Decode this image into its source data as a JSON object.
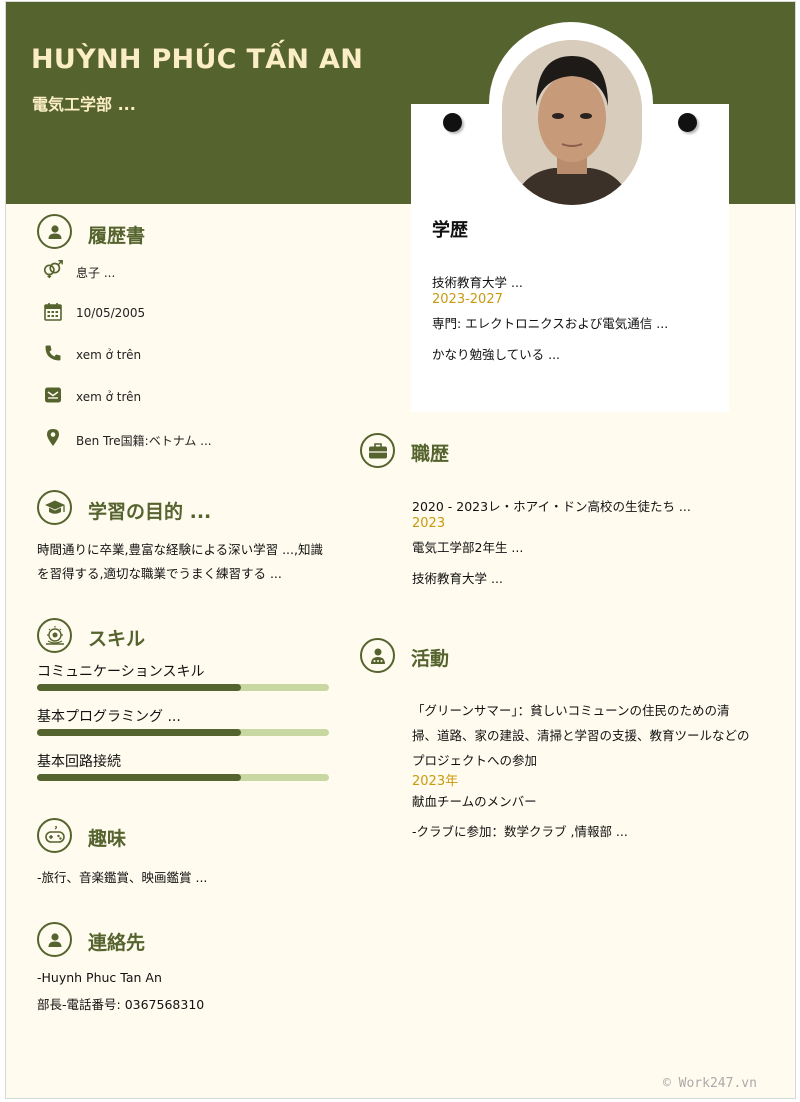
{
  "header": {
    "name": "HUỲNH PHÚC TẤN AN",
    "subtitle": "電気工学部 ..."
  },
  "profile": {
    "title": "履歴書",
    "items": [
      {
        "icon": "gender-icon",
        "text": "息子 ..."
      },
      {
        "icon": "calendar-icon",
        "text": "10/05/2005"
      },
      {
        "icon": "phone-icon",
        "text": "xem ở trên"
      },
      {
        "icon": "email-icon",
        "text": "xem ở trên"
      },
      {
        "icon": "location-icon",
        "text": "Ben Tre国籍:ベトナム ..."
      }
    ]
  },
  "objective": {
    "title": "学習の目的 ...",
    "lines": [
      "時間通りに卒業,豊富な経験による深い学習 ...,知識",
      "を習得する,適切な職業でうまく練習する ..."
    ]
  },
  "skills": {
    "title": "スキル",
    "items": [
      {
        "label": "コミュニケーションスキル",
        "level": 0.7
      },
      {
        "label": "基本プログラミング ...",
        "level": 0.7
      },
      {
        "label": "基本回路接続",
        "level": 0.7
      }
    ]
  },
  "hobbies": {
    "title": "趣味",
    "text": "-旅行、音楽鑑賞、映画鑑賞 ..."
  },
  "contact": {
    "title": "連絡先",
    "name": "-Huynh Phuc Tan An",
    "phone": "部長-電話番号: 0367568310"
  },
  "education": {
    "title": "学歴",
    "school": "技術教育大学 ...",
    "years": "2023-2027",
    "major": "専門: エレクトロニクスおよび電気通信 ...",
    "note": "かなり勉強している ..."
  },
  "experience": {
    "title": "職歴",
    "line1": "2020 - 2023レ・ホアイ・ドン高校の生徒たち ...",
    "year": "2023",
    "line2": "電気工学部2年生 ...",
    "line3": "技術教育大学 ..."
  },
  "activities": {
    "title": "活動",
    "lines": [
      "「グリーンサマー」：貧しいコミューンの住民のための清",
      "掃、道路、家の建設、清掃と学習の支援、教育ツールなどの",
      "プロジェクトへの参加"
    ],
    "year": "2023年",
    "line_after": "献血チームのメンバー",
    "clubs": "-クラブに参加：数学クラブ ,情報部 ..."
  },
  "watermark": "© Work247.vn",
  "colors": {
    "primary": "#55632e",
    "cream": "#fffbee",
    "accent": "#c89a10",
    "bar_track": "#c9d8a3"
  }
}
